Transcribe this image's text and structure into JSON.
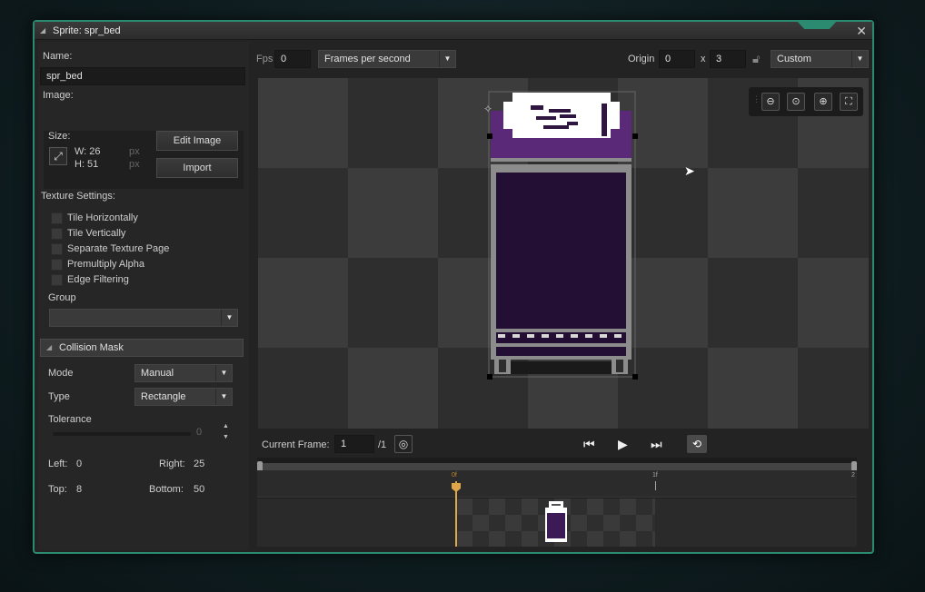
{
  "window": {
    "title": "Sprite: spr_bed",
    "close_glyph": "✕"
  },
  "left": {
    "name_label": "Name:",
    "name_value": "spr_bed",
    "image_label": "Image:",
    "size_label": "Size:",
    "width_text": "W: 26",
    "height_text": "H: 51",
    "px1": "px",
    "px2": "px",
    "edit_image_label": "Edit Image",
    "import_label": "Import",
    "texture_settings_label": "Texture Settings:",
    "checkboxes": [
      "Tile Horizontally",
      "Tile Vertically",
      "Separate Texture Page",
      "Premultiply Alpha",
      "Edge Filtering"
    ],
    "group_label": "Group",
    "group_value": "",
    "collision_section": "Collision Mask",
    "mode_label": "Mode",
    "mode_value": "Manual",
    "type_label": "Type",
    "type_value": "Rectangle",
    "tolerance_label": "Tolerance",
    "tolerance_value": "0",
    "left_label": "Left:",
    "left_value": "0",
    "right_label": "Right:",
    "right_value": "25",
    "top_label": "Top:",
    "top_value": "8",
    "bottom_label": "Bottom:",
    "bottom_value": "50"
  },
  "toolbar": {
    "fps_label": "Fps",
    "fps_value": "0",
    "fps_mode": "Frames per second",
    "origin_label": "Origin",
    "origin_x": "0",
    "origin_sep": "x",
    "origin_y": "3",
    "origin_preset": "Custom"
  },
  "playback": {
    "current_frame_label": "Current Frame:",
    "current_frame_value": "1",
    "frame_total": "/1"
  },
  "timeline": {
    "tick_0": "0f",
    "tick_1": "1f",
    "tick_2": "2"
  },
  "colors": {
    "accent": "#2a8b70",
    "playhead": "#e0a64a",
    "bed_purple": "#230f33",
    "bed_rim": "#5a2a78",
    "frame_gray": "#8c8c8c"
  }
}
